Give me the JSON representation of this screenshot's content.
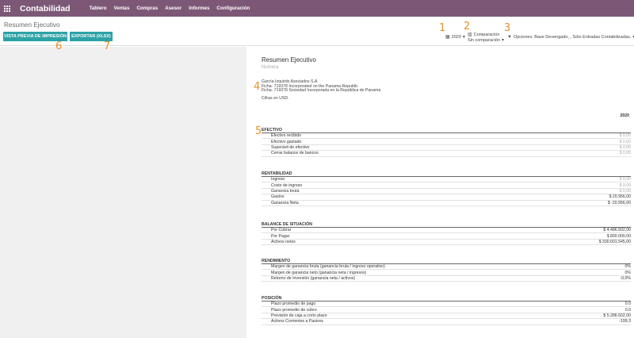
{
  "app": {
    "title": "Contabilidad"
  },
  "menu": [
    "Tablero",
    "Ventas",
    "Compras",
    "Asesor",
    "Informes",
    "Configuración"
  ],
  "breadcrumb": "Resumen Ejecutivo",
  "buttons": {
    "preview": "VISTA PREVIA DE IMPRESIÓN",
    "export": "EXPORTAR (XLSX)"
  },
  "filters": {
    "date": "2020",
    "comparison": "Comparación",
    "comparison_value": "Sin comparación",
    "options": "Opciones: Base Devengado, , Sólo Entradas Contabilizadas,"
  },
  "annotations": [
    "1",
    "2",
    "3",
    "4",
    "5",
    "6",
    "7"
  ],
  "report": {
    "title": "Resumen Ejecutivo",
    "subtitle": "Numera",
    "company_lines": [
      "García Izquirdo Asociados S.A.",
      "Ficha: 719378 Incorporated on the Panama Republic",
      "Ficha: 719378 Sociedad Incorporada en la República de Panamá"
    ],
    "currency_note": "Cifras en USD.",
    "year_header": "2020",
    "sections": [
      {
        "title": "EFECTIVO",
        "rows": [
          {
            "label": "Efectivo recibido",
            "value": "$ 0,00"
          },
          {
            "label": "Efectivo gastado",
            "value": "$ 0,00"
          },
          {
            "label": "Superávit de efectivo",
            "value": "$ 0,00"
          },
          {
            "label": "Cerrar balance de bancos",
            "value": "$ 0,00"
          }
        ]
      },
      {
        "title": "RENTABILIDAD",
        "rows": [
          {
            "label": "Ingreso",
            "value": "$ 0,00"
          },
          {
            "label": "Costo de ingreso",
            "value": "$ 0,00"
          },
          {
            "label": "Ganancia bruta",
            "value": "$ 0,00"
          },
          {
            "label": "Gastos",
            "value": "$ 20.956,00"
          },
          {
            "label": "Ganancia Neta",
            "value": "$ -20.956,00"
          }
        ]
      },
      {
        "title": "BALANCE DE SITUACIÓN",
        "rows": [
          {
            "label": "Por Cobrar",
            "value": "$ 4.486.502,00"
          },
          {
            "label": "Por Pagar",
            "value": "$ 800.000,00"
          },
          {
            "label": "Activos netos",
            "value": "$ 330.601.545,00"
          }
        ]
      },
      {
        "title": "RENDIMIENTO",
        "rows": [
          {
            "label": "Margen de ganancia bruta (ganancia bruta / ingreso operativo)",
            "value": "0%"
          },
          {
            "label": "Margen de ganancia neto (ganancia neta / ingresos)",
            "value": "0%"
          },
          {
            "label": "Retorno de Inversión (ganancia neta / activos)",
            "value": "-0,0%"
          }
        ]
      },
      {
        "title": "POSICIÓN",
        "rows": [
          {
            "label": "Plazo promedio de pago",
            "value": "0.0"
          },
          {
            "label": "Plazo promedio de cobro",
            "value": "0.0"
          },
          {
            "label": "Previsión de caja a corto plazo",
            "value": "$ 5.286.502,00"
          },
          {
            "label": "Activos Corrientes a Pasivos",
            "value": "-199.3"
          }
        ]
      }
    ]
  }
}
